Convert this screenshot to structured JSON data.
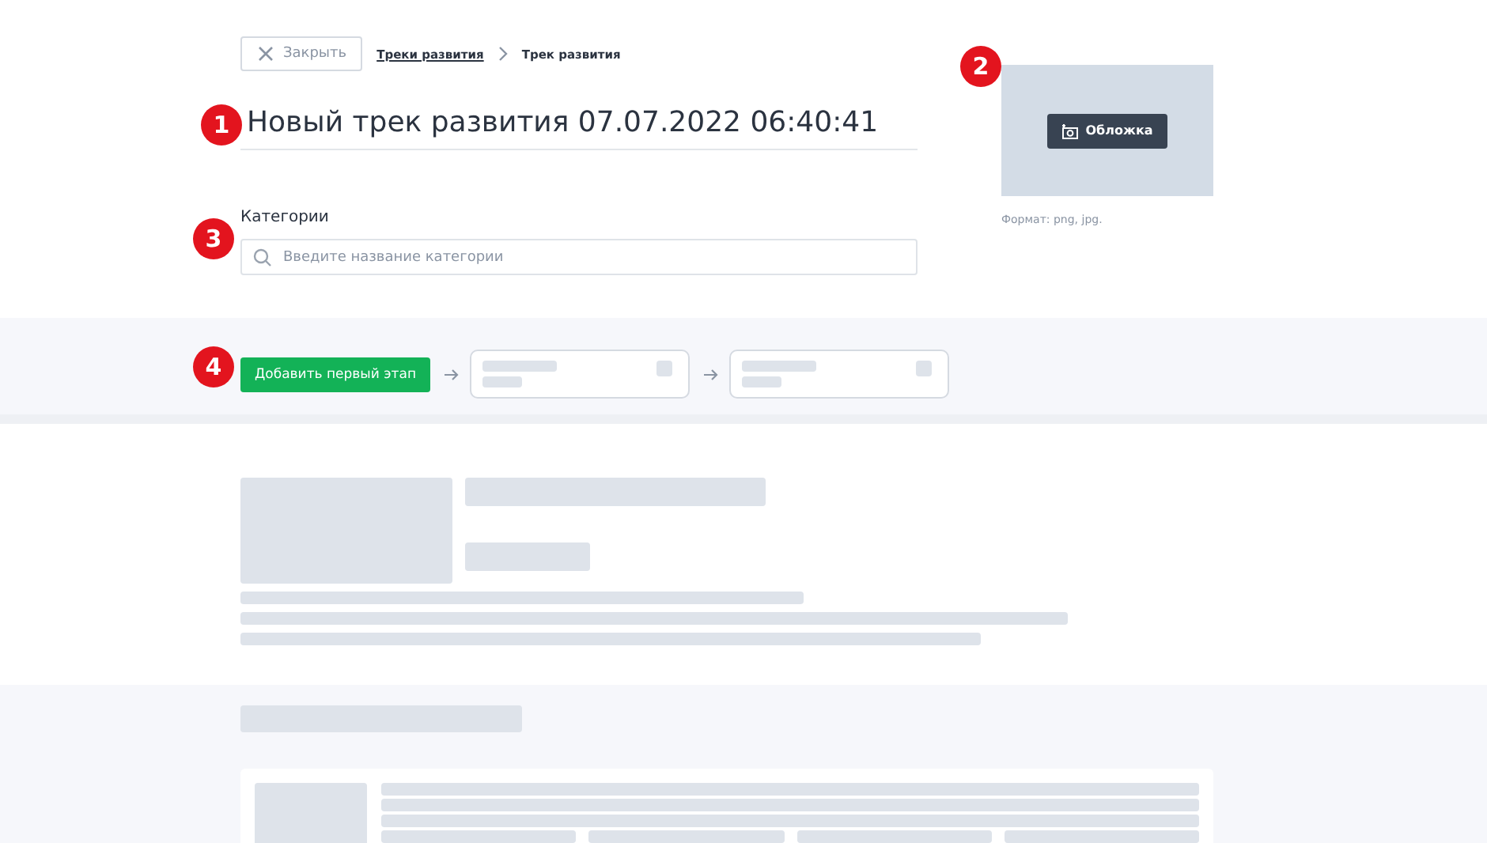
{
  "close_button": {
    "label": "Закрыть"
  },
  "breadcrumbs": [
    {
      "label": "Треки развития",
      "link": true
    },
    {
      "label": "Трек развития",
      "link": false
    }
  ],
  "title": "Новый трек развития 07.07.2022 06:40:41",
  "categories": {
    "label": "Категории",
    "placeholder": "Введите название категории"
  },
  "cover": {
    "button": "Обложка",
    "hint": "Формат: png, jpg."
  },
  "stages": {
    "add_button": "Добавить первый этап"
  },
  "markers": [
    "1",
    "2",
    "3",
    "4"
  ]
}
